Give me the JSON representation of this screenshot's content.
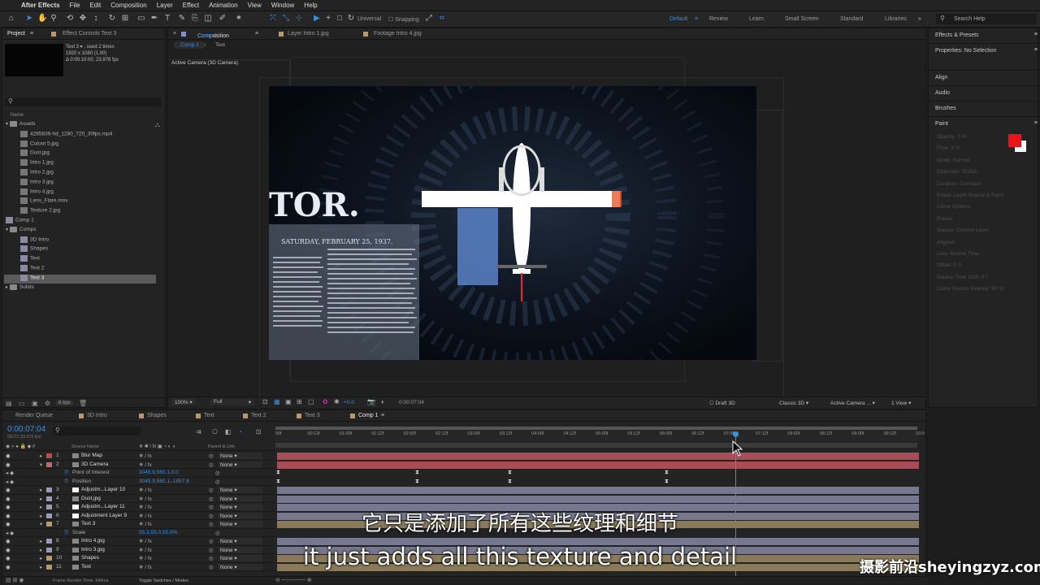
{
  "menubar": {
    "app": "After Effects",
    "items": [
      "File",
      "Edit",
      "Composition",
      "Layer",
      "Effect",
      "Animation",
      "View",
      "Window",
      "Help"
    ]
  },
  "toolbar": {
    "universal": "Universal",
    "snapping": "Snapping",
    "search_placeholder": "Search Help",
    "workspaces": [
      "Default",
      "Review",
      "Learn",
      "Small Screen",
      "Standard",
      "Libraries"
    ]
  },
  "project": {
    "tab": "Project",
    "tab2": "Effect Controls Text 3",
    "info": [
      "Text 3 ▾ , used 2 times",
      "1920 x 1080 (1.00)",
      "Δ 0:00:10:00, 23.976 fps"
    ],
    "col_name": "Name",
    "items": [
      {
        "name": "Assets",
        "type": "folder",
        "depth": 0
      },
      {
        "name": "4285836-hd_1280_720_30fps.mp4",
        "type": "file",
        "depth": 1
      },
      {
        "name": "Cutout 5.jpg",
        "type": "file",
        "depth": 1
      },
      {
        "name": "Dust.jpg",
        "type": "file",
        "depth": 1
      },
      {
        "name": "Intro 1.jpg",
        "type": "file",
        "depth": 1
      },
      {
        "name": "Intro 2.jpg",
        "type": "file",
        "depth": 1
      },
      {
        "name": "Intro 3.jpg",
        "type": "file",
        "depth": 1
      },
      {
        "name": "Intro 4.jpg",
        "type": "file",
        "depth": 1
      },
      {
        "name": "Lens_Flare.mov",
        "type": "file",
        "depth": 1
      },
      {
        "name": "Texture 2.jpg",
        "type": "file",
        "depth": 1
      },
      {
        "name": "Comp 1",
        "type": "comp",
        "depth": 0
      },
      {
        "name": "Comps",
        "type": "folder",
        "depth": 0
      },
      {
        "name": "3D Intro",
        "type": "comp",
        "depth": 1
      },
      {
        "name": "Shapes",
        "type": "comp",
        "depth": 1
      },
      {
        "name": "Text",
        "type": "comp",
        "depth": 1
      },
      {
        "name": "Text 2",
        "type": "comp",
        "depth": 1
      },
      {
        "name": "Text 3",
        "type": "comp",
        "depth": 1,
        "selected": true
      },
      {
        "name": "Solids",
        "type": "folder",
        "depth": 0
      }
    ],
    "bpc": "8 bpc"
  },
  "viewer": {
    "tab": "Composition",
    "tab_comp": "Comp 1",
    "tab2": "Layer Intro 1.jpg",
    "tab3": "Footage Intro 4.jpg",
    "breadcrumb": [
      "Comp 1",
      "Text"
    ],
    "camera_label": "Active Camera (3D Camera)",
    "zoom": "100%",
    "resolution": "Full",
    "exposure": "+0.0",
    "timecode": "0:00:07:04",
    "draft3d": "Draft 3D",
    "renderer": "Classic 3D",
    "view": "Active Camera ...",
    "views": "1 View",
    "frame_text": "TOR.",
    "frame_date": "SATURDAY, FEBRUARY 25, 1937."
  },
  "right": {
    "effects": "Effects & Presets",
    "properties": "Properties: No Selection",
    "align": "Align",
    "audio": "Audio",
    "brushes": "Brushes",
    "paint": "Paint",
    "paint_fields": [
      "Opacity: 0 %",
      "Flow: 5 %",
      "Mode: Normal",
      "Channels: RGBA",
      "Duration: Constant",
      "Erase: Layer Source & Paint",
      "Clone Options",
      "Preset:",
      "Source: Current Layer",
      "Aligned",
      "Lock Source Time",
      "Offset: 0   0",
      "Source Time Shift: 0 f",
      "Clone Source Overlay: 50 %"
    ],
    "fg_color": "#e8141a",
    "bg_color": "#ffffff"
  },
  "timeline": {
    "tabs": [
      "Render Queue",
      "3D Intro",
      "Shapes",
      "Text",
      "Text 2",
      "Text 3",
      "Comp 1"
    ],
    "active_tab": "Comp 1",
    "timecode": "0:00:07:04",
    "frame": "00172 (23.976 fps)",
    "col_source": "Source Name",
    "col_parent": "Parent & Link",
    "ticks": [
      "00f",
      "00:12f",
      "01:00f",
      "01:12f",
      "02:00f",
      "02:12f",
      "03:00f",
      "03:12f",
      "04:00f",
      "04:12f",
      "05:00f",
      "05:12f",
      "06:00f",
      "06:12f",
      "07:00f",
      "07:12f",
      "08:00f",
      "08:12f",
      "09:00f",
      "09:12f",
      "10:0"
    ],
    "layers": [
      {
        "num": "1",
        "name": "Blur Map",
        "parent": "None",
        "color": "#c04a4a",
        "bar": "#a84c55"
      },
      {
        "num": "2",
        "name": "3D Camera",
        "parent": "None",
        "color": "#c06a6a",
        "bar": "#a84c55"
      },
      {
        "num": "",
        "name": "Point of Interest",
        "value": "3045.9,560.1,0.0",
        "prop": true
      },
      {
        "num": "",
        "name": "Position",
        "value": "3045.9,560.1,-1857.8",
        "prop": true
      },
      {
        "num": "3",
        "name": "Adjustm...Layer 10",
        "parent": "None",
        "color": "#9a9ab8",
        "bar": "#777790"
      },
      {
        "num": "4",
        "name": "Dust.jpg",
        "parent": "None",
        "color": "#9a9ab8",
        "bar": "#777790"
      },
      {
        "num": "5",
        "name": "Adjustm...Layer 11",
        "parent": "None",
        "color": "#9a9ab8",
        "bar": "#777790"
      },
      {
        "num": "6",
        "name": "Adjustment Layer 9",
        "parent": "None",
        "color": "#9a9ab8",
        "bar": "#777790"
      },
      {
        "num": "7",
        "name": "Text 3",
        "parent": "None",
        "color": "#b89a6a",
        "bar": "#8a7a5a"
      },
      {
        "num": "",
        "name": "Scale",
        "value": "55.3,55.0,55.0%",
        "prop": true
      },
      {
        "num": "8",
        "name": "Intro 4.jpg",
        "parent": "None",
        "color": "#9a9ab8",
        "bar": "#777790"
      },
      {
        "num": "9",
        "name": "Intro 3.jpg",
        "parent": "None",
        "color": "#9a9ab8",
        "bar": "#777790"
      },
      {
        "num": "10",
        "name": "Shapes",
        "parent": "None",
        "color": "#b89a6a",
        "bar": "#8a7a5a"
      },
      {
        "num": "11",
        "name": "Text",
        "parent": "None",
        "color": "#b89a6a",
        "bar": "#8a7a5a"
      }
    ],
    "render_time": "Frame Render Time: 349ms",
    "toggle": "Toggle Switches / Modes",
    "playhead_fraction": 0.717
  },
  "subtitles": {
    "zh": "它只是添加了所有这些纹理和细节",
    "en": "it just adds all this texture and detail"
  },
  "watermark": "摄影前沿sheyingzyz.com"
}
